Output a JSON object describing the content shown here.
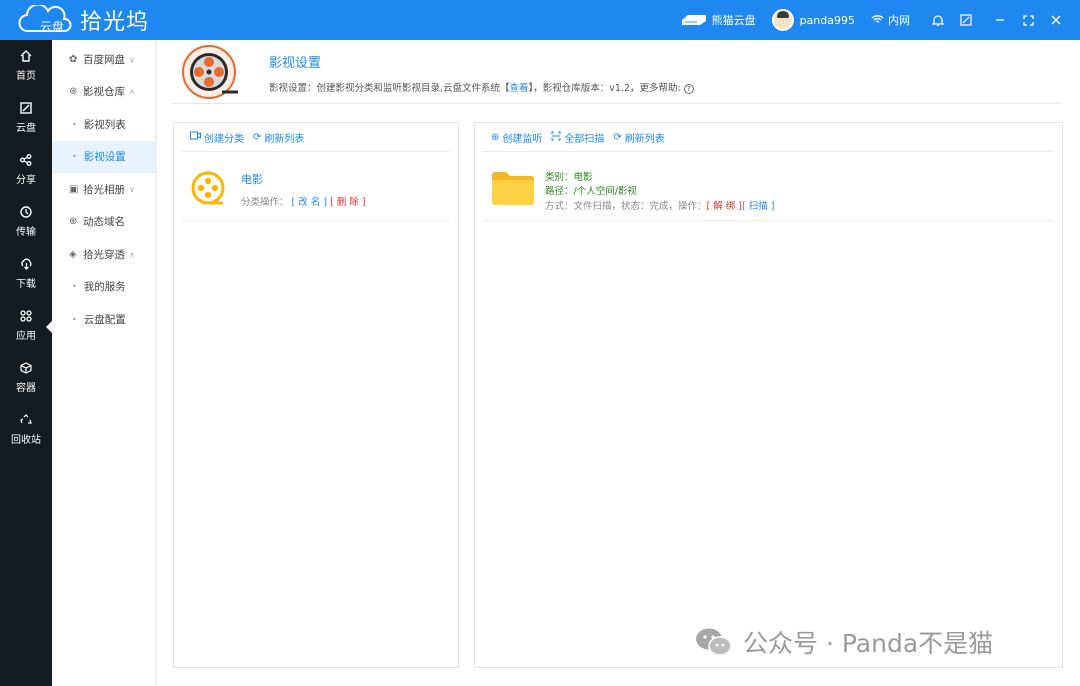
{
  "app": {
    "logo_text": "云盘",
    "brand": "拾光坞",
    "device": "熊猫云盘",
    "user": "panda995",
    "network": "内网"
  },
  "leftnav": [
    {
      "label": "首页",
      "icon": "home-icon"
    },
    {
      "label": "云盘",
      "icon": "disk-icon"
    },
    {
      "label": "分享",
      "icon": "share-icon"
    },
    {
      "label": "传输",
      "icon": "transfer-icon"
    },
    {
      "label": "下载",
      "icon": "download-icon"
    },
    {
      "label": "应用",
      "icon": "apps-icon"
    },
    {
      "label": "容器",
      "icon": "container-icon"
    },
    {
      "label": "回收站",
      "icon": "recycle-icon"
    }
  ],
  "submenu": [
    {
      "label": "百度网盘",
      "icon": "paw-icon",
      "arrow": "﹀"
    },
    {
      "label": "影视仓库",
      "icon": "film-icon",
      "arrow": "︿"
    },
    {
      "label": "影视列表"
    },
    {
      "label": "影视设置"
    },
    {
      "label": "拾光相册",
      "icon": "image-icon",
      "arrow": "﹀"
    },
    {
      "label": "动态域名",
      "icon": "globe-icon"
    },
    {
      "label": "拾光穿透",
      "icon": "layers-icon",
      "arrow": "︿"
    },
    {
      "label": "我的服务"
    },
    {
      "label": "云盘配置"
    }
  ],
  "header": {
    "title": "影视设置",
    "desc_prefix": "影视设置：创建影视分类和监听影视目录,云盘文件系统【",
    "desc_link": "查看",
    "desc_mid": "】，影视仓库版本：v1.2，更多帮助:",
    "help": "?"
  },
  "left_panel": {
    "tool_create": "创建分类",
    "tool_refresh": "刷新列表",
    "category_name": "电影",
    "ops_label": "分类操作：",
    "edit": "[ 改 名 ]",
    "delete": "[ 删 除 ]"
  },
  "right_panel": {
    "tool_listen": "创建监听",
    "tool_scan": "全部扫描",
    "tool_refresh": "刷新列表",
    "category": "类别：电影",
    "path": "路径：/个人空间/影视",
    "status": "方式：文件扫描，状态：完成，操作：",
    "unbind": "[ 解 绑 ]",
    "scan": "[ 扫描 ]"
  },
  "watermark": "公众号 · Panda不是猫",
  "colors": {
    "accent": "#1e88f0",
    "sidebar": "#161a21",
    "danger": "#e5332a",
    "ok": "#2a8a1a",
    "folder": "#ffc83d"
  }
}
